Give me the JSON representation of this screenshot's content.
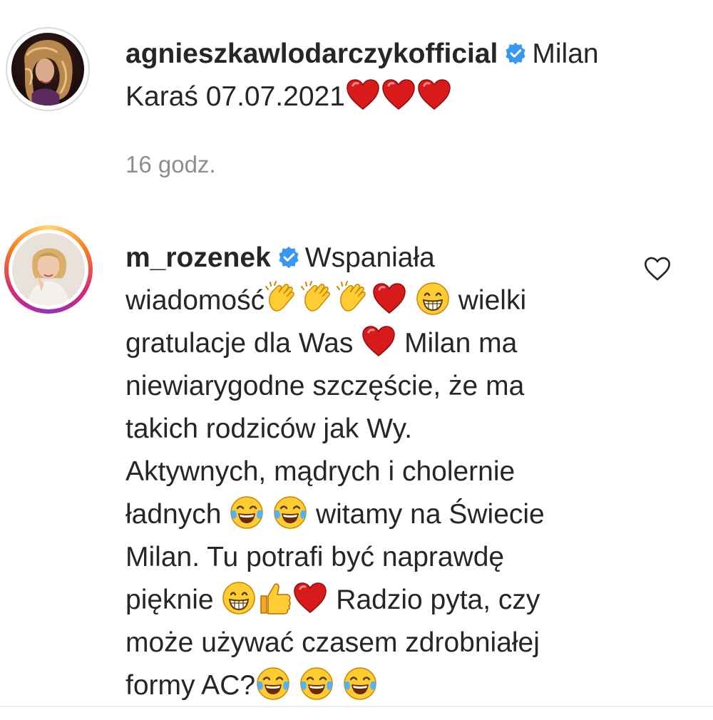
{
  "comments": [
    {
      "username": "agnieszkawlodarczykofficial",
      "verified": true,
      "text": [
        "Milan",
        "Karaś 07.07.2021"
      ],
      "emojis_after": [
        "heart",
        "heart",
        "heart"
      ],
      "time": "16 godz."
    },
    {
      "username": "m_rozenek",
      "verified": true,
      "text": {
        "s1": "Wspaniała",
        "s2": "wiadomość",
        "s3": "wielki",
        "s4": "gratulacje dla Was",
        "s5": "Milan ma",
        "s6": "niewiarygodne szczęście, że ma",
        "s7": "takich rodziców jak Wy.",
        "s8": "Aktywnych, mądrych i cholernie",
        "s9": "ładnych",
        "s10": "witamy na Świecie",
        "s11": "Milan. Tu potrafi być naprawdę",
        "s12": "pięknie",
        "s13": "Radzio pyta, czy",
        "s14": "może używać czasem zdrobniałej",
        "s15": "formy AC?"
      },
      "like_icon": "heart-outline-icon"
    }
  ],
  "colors": {
    "verified": "#3897f0",
    "heart": "#e02424",
    "muted": "#8e8e8e",
    "text": "#262626"
  }
}
